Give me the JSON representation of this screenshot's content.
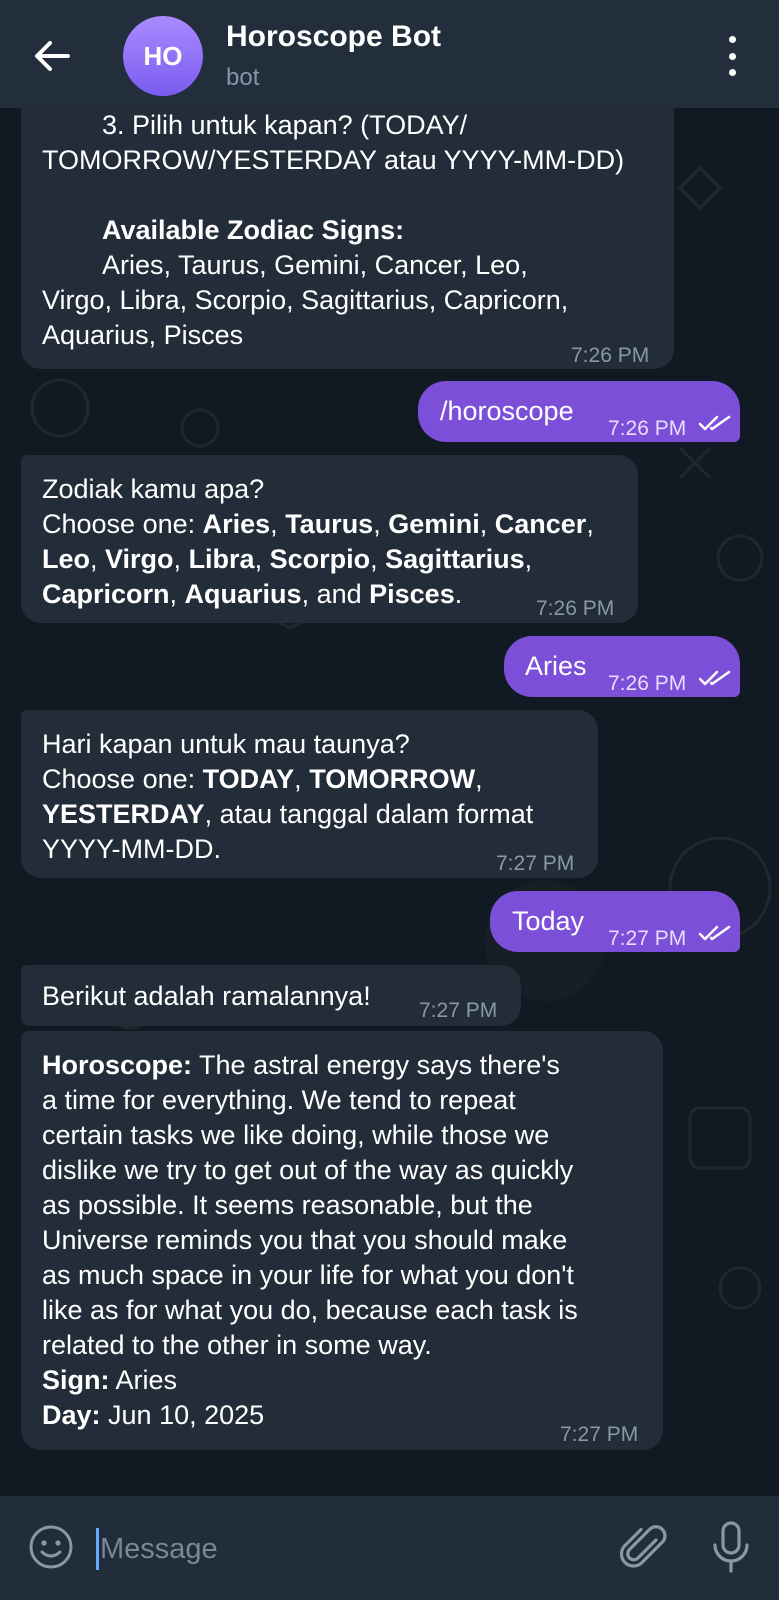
{
  "header": {
    "avatar_initials": "HO",
    "title": "Horoscope Bot",
    "subtitle": "bot"
  },
  "messages": {
    "m1": {
      "line1": "3. Pilih untuk kapan? (TODAY/",
      "line2": "TOMORROW/YESTERDAY atau YYYY-MM-DD)",
      "heading": "Available Zodiac Signs:",
      "line3": "Aries, Taurus, Gemini, Cancer, Leo,",
      "line4": "Virgo, Libra, Scorpio, Sagittarius, Capricorn,",
      "line5": "Aquarius, Pisces",
      "time": "7:26 PM"
    },
    "m2": {
      "text": "/horoscope",
      "time": "7:26 PM"
    },
    "m3": {
      "line1": "Zodiak kamu apa?",
      "prefix": "Choose one: ",
      "signs": [
        "Aries",
        "Taurus",
        "Gemini",
        "Cancer",
        "Leo",
        "Virgo",
        "Libra",
        "Scorpio",
        "Sagittarius",
        "Capricorn",
        "Aquarius",
        "Pisces"
      ],
      "comma": ", ",
      "and": ", and ",
      "period": ".",
      "time": "7:26 PM"
    },
    "m4": {
      "text": "Aries",
      "time": "7:26 PM"
    },
    "m5": {
      "line1": "Hari kapan untuk mau taunya?",
      "prefix": "Choose one: ",
      "opt1": "TODAY",
      "comma1": ", ",
      "opt2": "TOMORROW",
      "comma2": ",",
      "opt3": "YESTERDAY",
      "rest": ", atau tanggal dalam format",
      "line4": "YYYY-MM-DD.",
      "time": "7:27 PM"
    },
    "m6": {
      "text": "Today",
      "time": "7:27 PM"
    },
    "m7": {
      "text": "Berikut adalah ramalannya!",
      "time": "7:27 PM"
    },
    "m8": {
      "label": "Horoscope:",
      "lines": [
        " The astral energy says there's",
        "a time for everything. We tend to repeat",
        "certain tasks we like doing, while those we",
        "dislike we try to get out of the way as quickly",
        "as possible. It seems reasonable, but the",
        "Universe reminds you that you should make",
        "as much space in your life for what you don't",
        "like as for what you do, because each task is",
        "related to the other in some way."
      ],
      "sign_label": "Sign:",
      "sign_value": " Aries",
      "day_label": "Day:",
      "day_value": " Jun 10, 2025",
      "time": "7:27 PM"
    }
  },
  "input": {
    "placeholder": "Message"
  }
}
